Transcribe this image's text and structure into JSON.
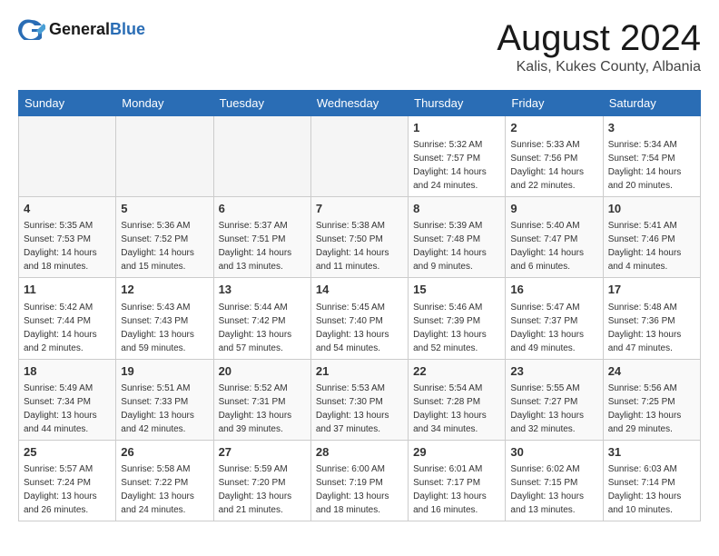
{
  "logo": {
    "general": "General",
    "blue": "Blue"
  },
  "header": {
    "month": "August 2024",
    "location": "Kalis, Kukes County, Albania"
  },
  "weekdays": [
    "Sunday",
    "Monday",
    "Tuesday",
    "Wednesday",
    "Thursday",
    "Friday",
    "Saturday"
  ],
  "weeks": [
    [
      {
        "day": "",
        "info": ""
      },
      {
        "day": "",
        "info": ""
      },
      {
        "day": "",
        "info": ""
      },
      {
        "day": "",
        "info": ""
      },
      {
        "day": "1",
        "info": "Sunrise: 5:32 AM\nSunset: 7:57 PM\nDaylight: 14 hours\nand 24 minutes."
      },
      {
        "day": "2",
        "info": "Sunrise: 5:33 AM\nSunset: 7:56 PM\nDaylight: 14 hours\nand 22 minutes."
      },
      {
        "day": "3",
        "info": "Sunrise: 5:34 AM\nSunset: 7:54 PM\nDaylight: 14 hours\nand 20 minutes."
      }
    ],
    [
      {
        "day": "4",
        "info": "Sunrise: 5:35 AM\nSunset: 7:53 PM\nDaylight: 14 hours\nand 18 minutes."
      },
      {
        "day": "5",
        "info": "Sunrise: 5:36 AM\nSunset: 7:52 PM\nDaylight: 14 hours\nand 15 minutes."
      },
      {
        "day": "6",
        "info": "Sunrise: 5:37 AM\nSunset: 7:51 PM\nDaylight: 14 hours\nand 13 minutes."
      },
      {
        "day": "7",
        "info": "Sunrise: 5:38 AM\nSunset: 7:50 PM\nDaylight: 14 hours\nand 11 minutes."
      },
      {
        "day": "8",
        "info": "Sunrise: 5:39 AM\nSunset: 7:48 PM\nDaylight: 14 hours\nand 9 minutes."
      },
      {
        "day": "9",
        "info": "Sunrise: 5:40 AM\nSunset: 7:47 PM\nDaylight: 14 hours\nand 6 minutes."
      },
      {
        "day": "10",
        "info": "Sunrise: 5:41 AM\nSunset: 7:46 PM\nDaylight: 14 hours\nand 4 minutes."
      }
    ],
    [
      {
        "day": "11",
        "info": "Sunrise: 5:42 AM\nSunset: 7:44 PM\nDaylight: 14 hours\nand 2 minutes."
      },
      {
        "day": "12",
        "info": "Sunrise: 5:43 AM\nSunset: 7:43 PM\nDaylight: 13 hours\nand 59 minutes."
      },
      {
        "day": "13",
        "info": "Sunrise: 5:44 AM\nSunset: 7:42 PM\nDaylight: 13 hours\nand 57 minutes."
      },
      {
        "day": "14",
        "info": "Sunrise: 5:45 AM\nSunset: 7:40 PM\nDaylight: 13 hours\nand 54 minutes."
      },
      {
        "day": "15",
        "info": "Sunrise: 5:46 AM\nSunset: 7:39 PM\nDaylight: 13 hours\nand 52 minutes."
      },
      {
        "day": "16",
        "info": "Sunrise: 5:47 AM\nSunset: 7:37 PM\nDaylight: 13 hours\nand 49 minutes."
      },
      {
        "day": "17",
        "info": "Sunrise: 5:48 AM\nSunset: 7:36 PM\nDaylight: 13 hours\nand 47 minutes."
      }
    ],
    [
      {
        "day": "18",
        "info": "Sunrise: 5:49 AM\nSunset: 7:34 PM\nDaylight: 13 hours\nand 44 minutes."
      },
      {
        "day": "19",
        "info": "Sunrise: 5:51 AM\nSunset: 7:33 PM\nDaylight: 13 hours\nand 42 minutes."
      },
      {
        "day": "20",
        "info": "Sunrise: 5:52 AM\nSunset: 7:31 PM\nDaylight: 13 hours\nand 39 minutes."
      },
      {
        "day": "21",
        "info": "Sunrise: 5:53 AM\nSunset: 7:30 PM\nDaylight: 13 hours\nand 37 minutes."
      },
      {
        "day": "22",
        "info": "Sunrise: 5:54 AM\nSunset: 7:28 PM\nDaylight: 13 hours\nand 34 minutes."
      },
      {
        "day": "23",
        "info": "Sunrise: 5:55 AM\nSunset: 7:27 PM\nDaylight: 13 hours\nand 32 minutes."
      },
      {
        "day": "24",
        "info": "Sunrise: 5:56 AM\nSunset: 7:25 PM\nDaylight: 13 hours\nand 29 minutes."
      }
    ],
    [
      {
        "day": "25",
        "info": "Sunrise: 5:57 AM\nSunset: 7:24 PM\nDaylight: 13 hours\nand 26 minutes."
      },
      {
        "day": "26",
        "info": "Sunrise: 5:58 AM\nSunset: 7:22 PM\nDaylight: 13 hours\nand 24 minutes."
      },
      {
        "day": "27",
        "info": "Sunrise: 5:59 AM\nSunset: 7:20 PM\nDaylight: 13 hours\nand 21 minutes."
      },
      {
        "day": "28",
        "info": "Sunrise: 6:00 AM\nSunset: 7:19 PM\nDaylight: 13 hours\nand 18 minutes."
      },
      {
        "day": "29",
        "info": "Sunrise: 6:01 AM\nSunset: 7:17 PM\nDaylight: 13 hours\nand 16 minutes."
      },
      {
        "day": "30",
        "info": "Sunrise: 6:02 AM\nSunset: 7:15 PM\nDaylight: 13 hours\nand 13 minutes."
      },
      {
        "day": "31",
        "info": "Sunrise: 6:03 AM\nSunset: 7:14 PM\nDaylight: 13 hours\nand 10 minutes."
      }
    ]
  ]
}
